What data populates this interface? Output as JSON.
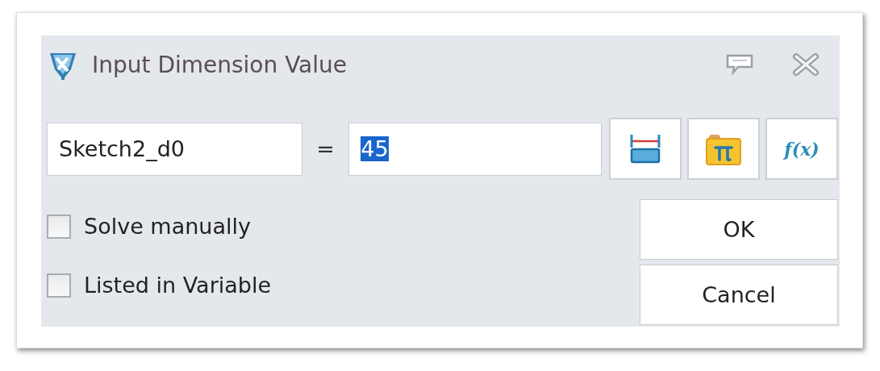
{
  "window": {
    "title": "Input Dimension Value"
  },
  "name_field": {
    "value": "Sketch2_d0"
  },
  "equals": "=",
  "value_field": {
    "value": "45",
    "text_selected": true
  },
  "tool_buttons": [
    {
      "kind": "dimension"
    },
    {
      "kind": "constant"
    },
    {
      "kind": "function",
      "label": "f(x)"
    }
  ],
  "options": [
    {
      "label": "Solve manually",
      "checked": false
    },
    {
      "label": "Listed in Variable",
      "checked": false
    }
  ],
  "buttons": [
    "OK",
    "Cancel"
  ]
}
